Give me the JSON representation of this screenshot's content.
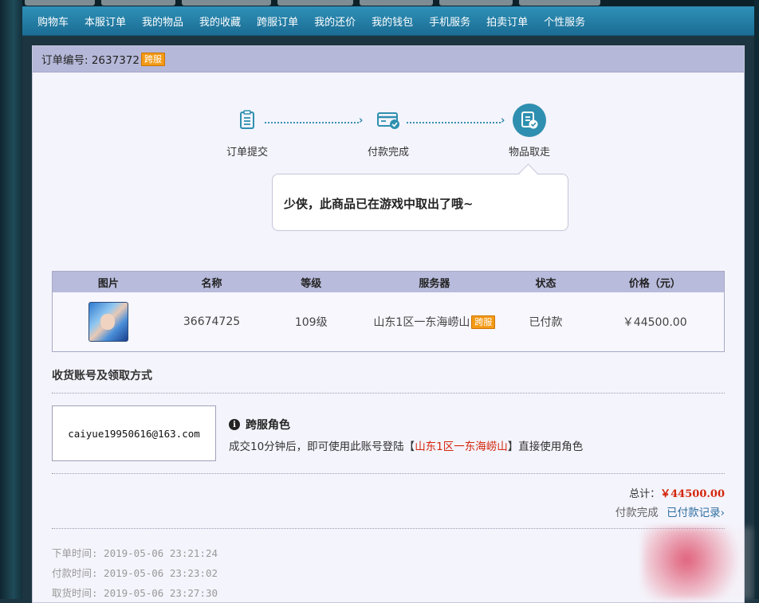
{
  "nav": {
    "items": [
      "购物车",
      "本服订单",
      "我的物品",
      "我的收藏",
      "跨服订单",
      "我的还价",
      "我的钱包",
      "手机服务",
      "拍卖订单",
      "个性服务"
    ]
  },
  "order": {
    "number_label": "订单编号: 2637372",
    "cross_tag": "跨服"
  },
  "steps": {
    "submit": "订单提交",
    "paid": "付款完成",
    "retrieved": "物品取走"
  },
  "bubble": {
    "text": "少侠，此商品已在游戏中取出了哦~"
  },
  "table": {
    "headers": [
      "图片",
      "名称",
      "等级",
      "服务器",
      "状态",
      "价格（元）"
    ],
    "row": {
      "name": "36674725",
      "level": "109级",
      "server": "山东1区一东海崂山",
      "server_tag": "跨服",
      "status": "已付款",
      "price": "￥44500.00"
    }
  },
  "delivery": {
    "title": "收货账号及领取方式",
    "account": "caiyue19950616@163.com",
    "info_title": "跨服角色",
    "desc_prefix": "成交10分钟后，即可使用此账号登陆【",
    "desc_server": "山东1区一东海崂山",
    "desc_suffix": "】直接使用角色"
  },
  "summary": {
    "total_label": "总计：",
    "total_value": "￥44500.00",
    "pay_status": "付款完成",
    "pay_link": "已付款记录"
  },
  "times": {
    "order": "下单时间: 2019-05-06 23:21:24",
    "pay": "付款时间: 2019-05-06 23:23:02",
    "retrieve": "取货时间: 2019-05-06 23:27:30"
  },
  "colors": {
    "nav_bg": "#2a86ae",
    "accent": "#2f8fb0",
    "price_red": "#d4260c",
    "tag_orange": "#f39a16"
  }
}
